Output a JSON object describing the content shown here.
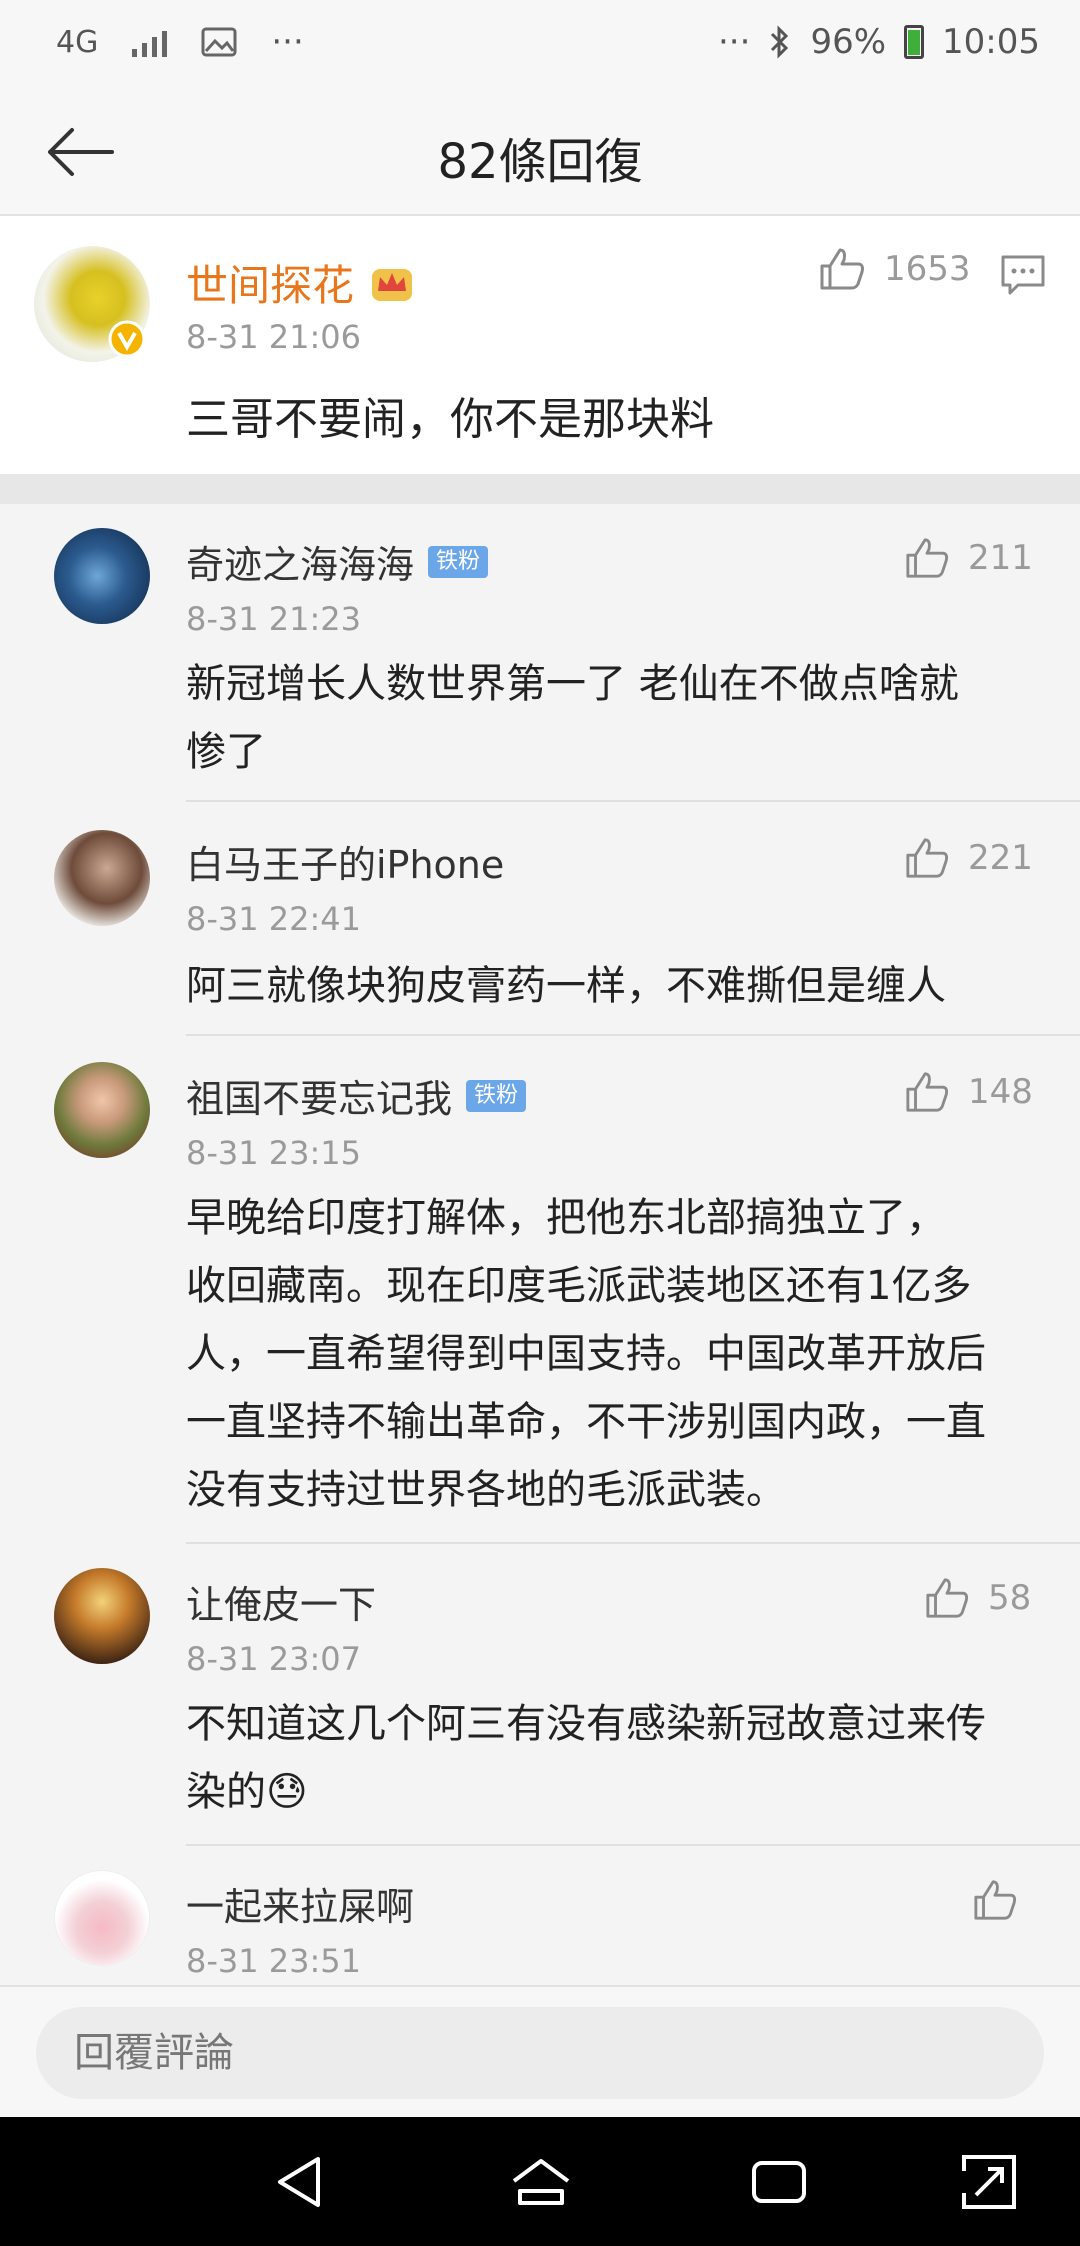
{
  "status": {
    "network": "4G",
    "more_left": "···",
    "more_right": "···",
    "battery": "96%",
    "time": "10:05"
  },
  "header": {
    "title": "82條回復"
  },
  "top_comment": {
    "author": "世间探花",
    "time": "8-31 21:06",
    "likes": "1653",
    "text": "三哥不要闹，你不是那块料"
  },
  "replies": [
    {
      "author": "奇迹之海海海",
      "badge": "铁粉",
      "time": "8-31 21:23",
      "likes": "211",
      "text_lines": [
        "新冠增长人数世界第一了 老仙在不做点啥就",
        "惨了"
      ]
    },
    {
      "author": "白马王子的iPhone",
      "badge": "",
      "time": "8-31 22:41",
      "likes": "221",
      "text_lines": [
        "阿三就像块狗皮膏药一样，不难撕但是缠人"
      ]
    },
    {
      "author": "祖国不要忘记我",
      "badge": "铁粉",
      "time": "8-31 23:15",
      "likes": "148",
      "text_lines": [
        "早晚给印度打解体，把他东北部搞独立了，",
        "收回藏南。现在印度毛派武装地区还有1亿多",
        "人，一直希望得到中国支持。中国改革开放后",
        "一直坚持不输出革命，不干涉别国内政，一直",
        "没有支持过世界各地的毛派武装。"
      ]
    },
    {
      "author": "让俺皮一下",
      "badge": "",
      "time": "8-31 23:07",
      "likes": "58",
      "text_lines": [
        "不知道这几个阿三有没有感染新冠故意过来传",
        "染的😓"
      ]
    },
    {
      "author": "一起来拉屎啊",
      "badge": "",
      "time": "8-31 23:51",
      "likes": "",
      "text_lines": []
    }
  ],
  "reply_input": {
    "placeholder": "回覆評論"
  },
  "colors": {
    "author_orange": "#e8761c",
    "badge_blue": "#6aa6e8",
    "verified_yellow": "#f5b400"
  }
}
